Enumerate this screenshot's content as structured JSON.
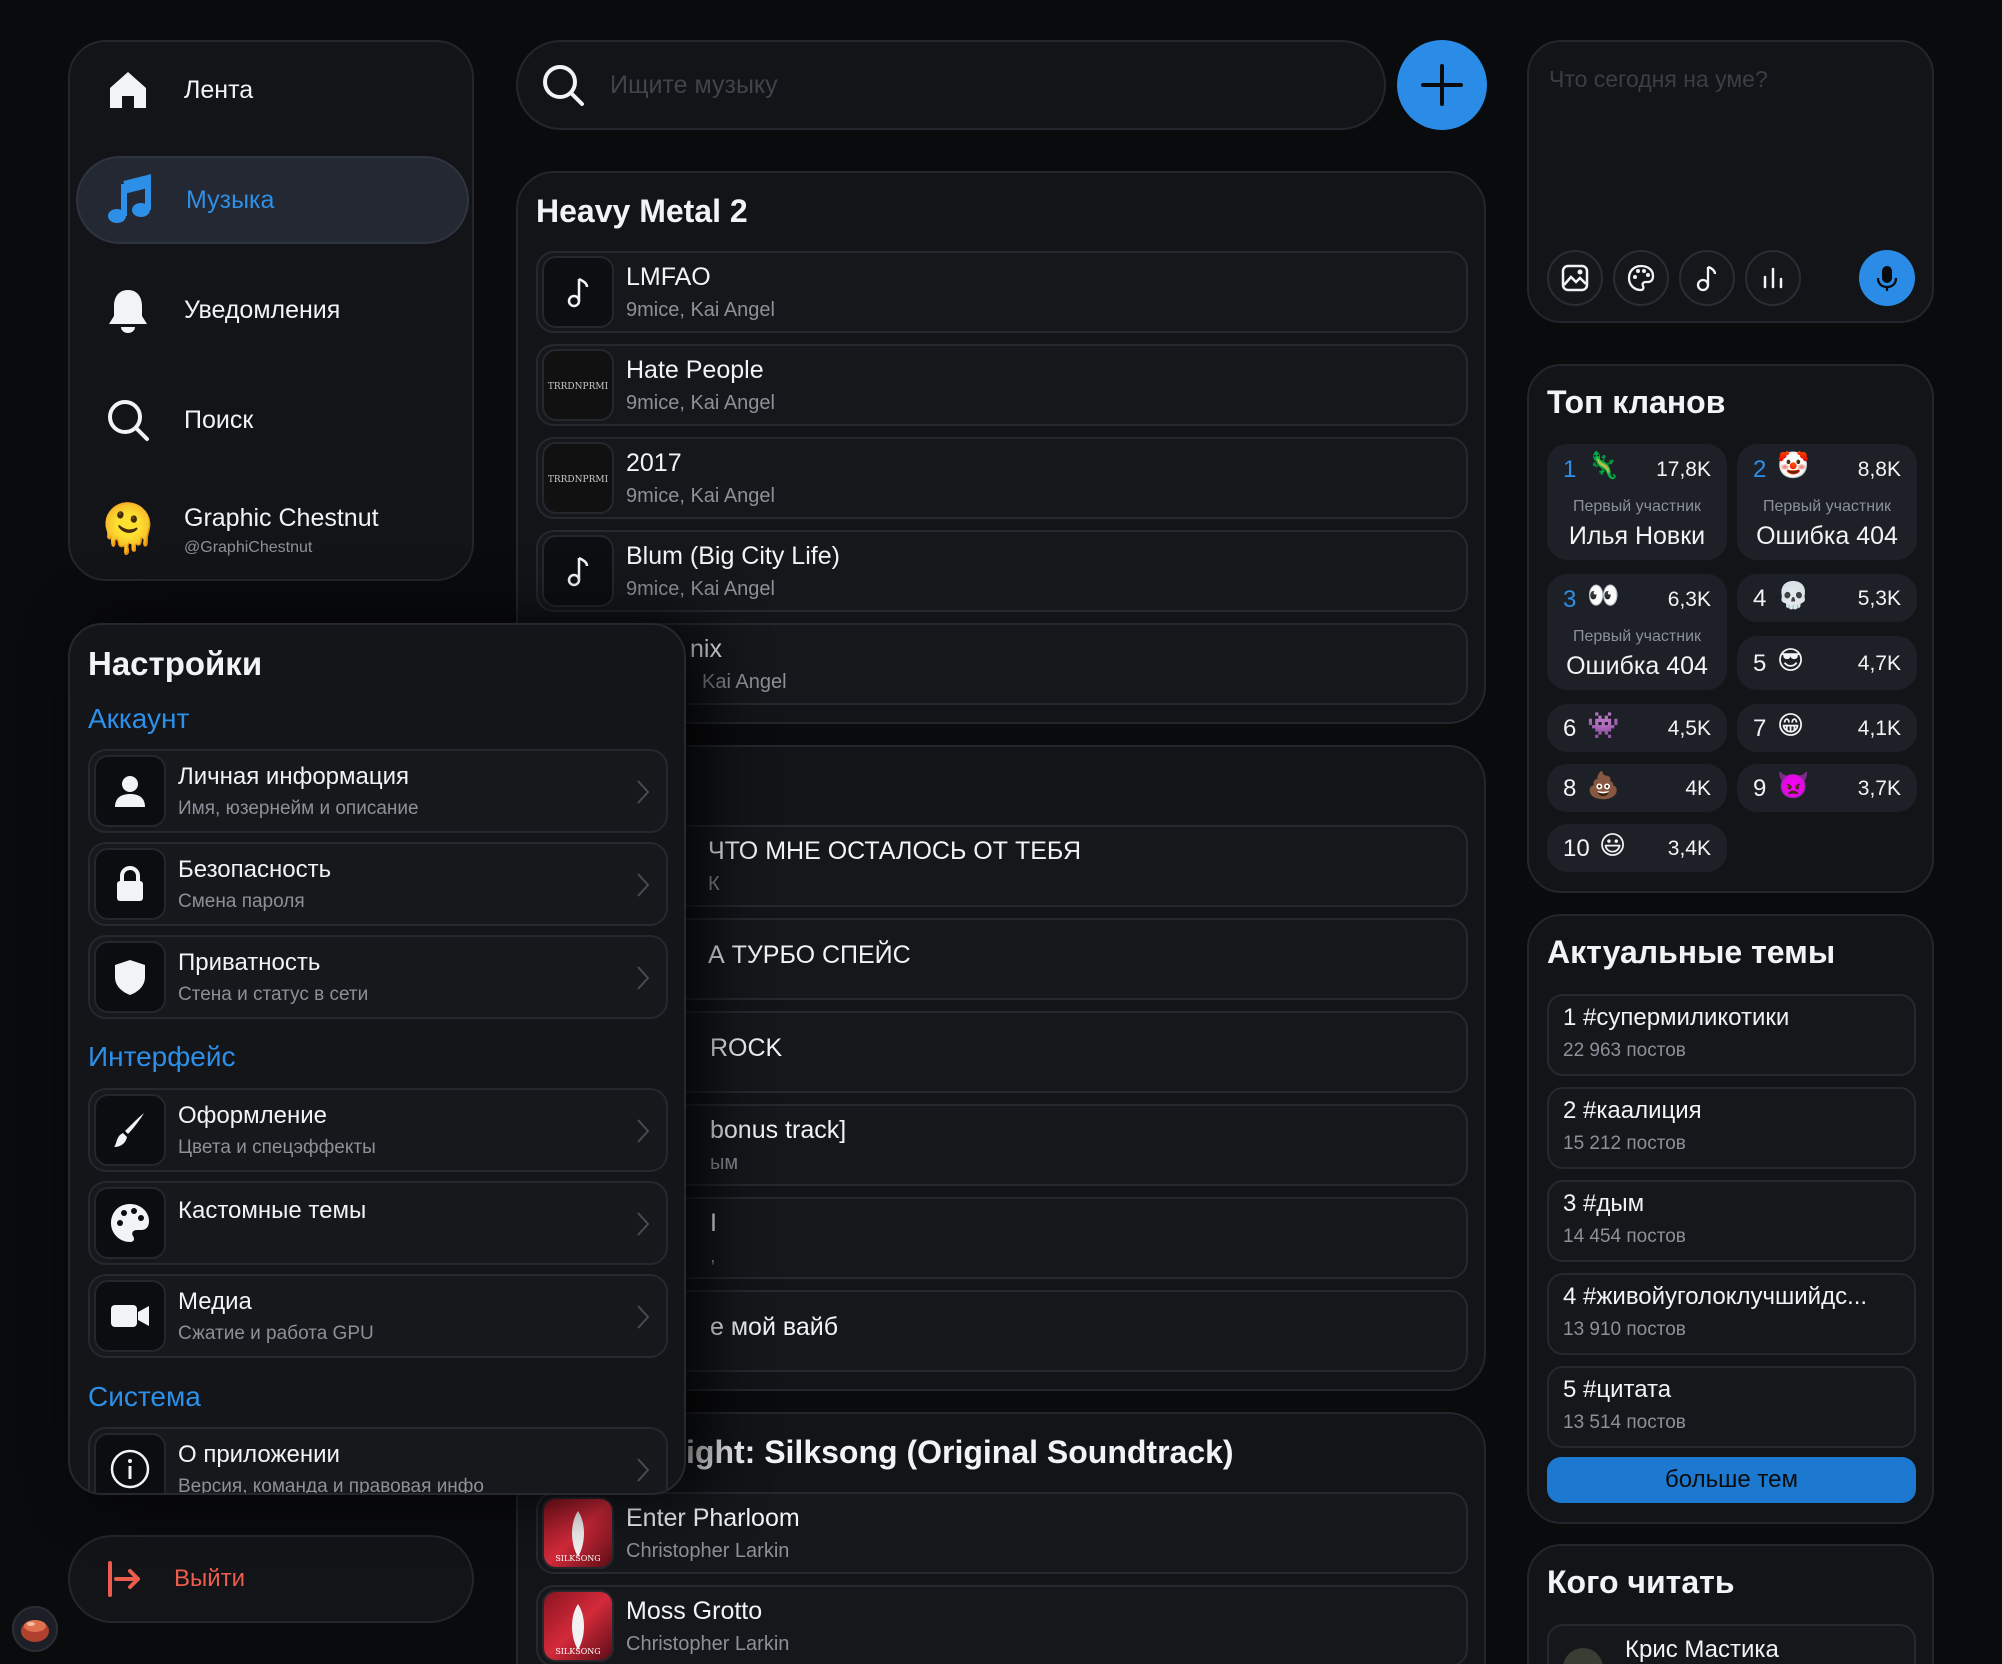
{
  "nav": {
    "items": [
      {
        "label": "Лента",
        "icon": "home-icon"
      },
      {
        "label": "Музыка",
        "icon": "music-note-icon"
      },
      {
        "label": "Уведомления",
        "icon": "bell-icon"
      },
      {
        "label": "Поиск",
        "icon": "search-icon"
      }
    ],
    "user": {
      "name": "Graphic Chestnut",
      "handle": "@GraphiChestnut"
    },
    "logout": "Выйти"
  },
  "search": {
    "placeholder": "Ищите музыку"
  },
  "playlists": [
    {
      "title": "Heavy Metal 2",
      "tracks": [
        {
          "name": "LMFAO",
          "artist": "9mice, Kai Angel",
          "cover": "music-note-icon"
        },
        {
          "name": "Hate People",
          "artist": "9mice, Kai Angel",
          "cover": "album-cover"
        },
        {
          "name": "2017",
          "artist": "9mice, Kai Angel",
          "cover": "album-cover"
        },
        {
          "name": "Blum (Big City Life)",
          "artist": "9mice, Kai Angel",
          "cover": "music-note-icon"
        },
        {
          "name": "nix",
          "artist": "Kai Angel",
          "cover": "hidden"
        }
      ]
    },
    {
      "title": "",
      "tracks": [
        {
          "name": "ЧТО МНЕ ОСТАЛОСЬ ОТ ТЕБЯ",
          "artist": "К"
        },
        {
          "name": "А ТУРБО СПЕЙС",
          "artist": ""
        },
        {
          "name": "ROCK",
          "artist": ""
        },
        {
          "name": "bonus track]",
          "artist": "ым"
        },
        {
          "name": "I",
          "artist": ","
        },
        {
          "name": "е мой вайб",
          "artist": ""
        }
      ]
    },
    {
      "title": "ight: Silksong (Original Soundtrack)",
      "tracks": [
        {
          "name": "Enter Pharloom",
          "artist": "Christopher Larkin"
        },
        {
          "name": "Moss Grotto",
          "artist": "Christopher Larkin"
        }
      ]
    }
  ],
  "settings": {
    "title": "Настройки",
    "sections": {
      "account": "Аккаунт",
      "interface": "Интерфейс",
      "system": "Система"
    },
    "items": [
      {
        "name": "Личная информация",
        "desc": "Имя, юзернейм и описание",
        "icon": "user-icon"
      },
      {
        "name": "Безопасность",
        "desc": "Смена пароля",
        "icon": "lock-icon"
      },
      {
        "name": "Приватность",
        "desc": "Стена и статус в сети",
        "icon": "shield-icon"
      },
      {
        "name": "Оформление",
        "desc": "Цвета и спецэффекты",
        "icon": "brush-icon"
      },
      {
        "name": "Кастомные темы",
        "desc": "",
        "icon": "palette-icon"
      },
      {
        "name": "Медиа",
        "desc": "Сжатие и работа GPU",
        "icon": "video-camera-icon"
      },
      {
        "name": "О приложении",
        "desc": "Версия, команда и правовая инфо",
        "icon": "info-icon"
      }
    ]
  },
  "composer": {
    "placeholder": "Что сегодня на уме?"
  },
  "clans": {
    "title": "Топ кланов",
    "member_label": "Первый участник",
    "items": [
      {
        "rank": "1",
        "emoji": "🦎",
        "count": "17,8K",
        "member": "Илья Новки"
      },
      {
        "rank": "2",
        "emoji": "🤡",
        "count": "8,8K",
        "member": "Ошибка 404"
      },
      {
        "rank": "3",
        "emoji": "👀",
        "count": "6,3K",
        "member": "Ошибка 404"
      },
      {
        "rank": "4",
        "emoji": "💀",
        "count": "5,3K"
      },
      {
        "rank": "5",
        "emoji": "😎",
        "count": "4,7K"
      },
      {
        "rank": "6",
        "emoji": "👾",
        "count": "4,5K"
      },
      {
        "rank": "7",
        "emoji": "😁",
        "count": "4,1K"
      },
      {
        "rank": "8",
        "emoji": "💩",
        "count": "4K"
      },
      {
        "rank": "9",
        "emoji": "👿",
        "count": "3,7K"
      },
      {
        "rank": "10",
        "emoji": "😃",
        "count": "3,4K"
      }
    ]
  },
  "topics": {
    "title": "Актуальные темы",
    "items": [
      {
        "name": "1 #супермиликотики",
        "count": "22 963 постов"
      },
      {
        "name": "2 #каалиция",
        "count": "15 212 постов"
      },
      {
        "name": "3 #дым",
        "count": "14 454 постов"
      },
      {
        "name": "4 #живойуголоклучшийдс...",
        "count": "13 910 постов"
      },
      {
        "name": "5 #цитата",
        "count": "13 514 постов"
      }
    ],
    "more": "больше тем"
  },
  "who_to_read": {
    "title": "Кого читать",
    "people": [
      {
        "name": "Крис Мастика"
      }
    ]
  },
  "colors": {
    "accent": "#2a8ce6",
    "danger": "#ec5d4e",
    "background": "#0a0b0d",
    "panel": "#121418"
  }
}
